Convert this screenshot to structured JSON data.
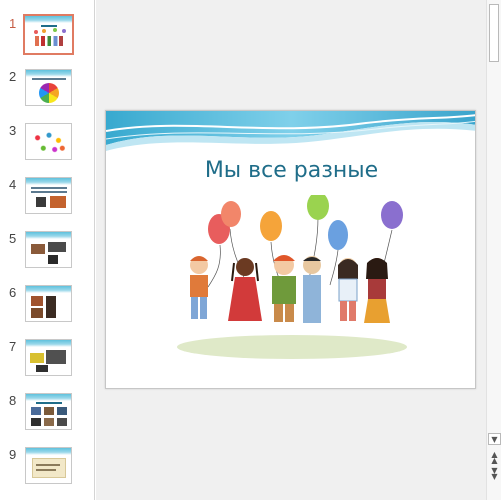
{
  "thumbnails": [
    {
      "number": "1",
      "selected": true
    },
    {
      "number": "2"
    },
    {
      "number": "3"
    },
    {
      "number": "4"
    },
    {
      "number": "5"
    },
    {
      "number": "6"
    },
    {
      "number": "7"
    },
    {
      "number": "8"
    },
    {
      "number": "9"
    }
  ],
  "slide": {
    "title": "Мы все разные",
    "picture_icon": "children-with-balloons-illustration"
  },
  "scrollbar": {
    "down_icon": "chevron-down-icon",
    "prev_icon": "double-chevron-up-icon",
    "next_icon": "double-chevron-down-icon"
  },
  "colors": {
    "accent": "#1f6d89",
    "selection": "#e07b62",
    "wave": "#5fc1dd"
  }
}
